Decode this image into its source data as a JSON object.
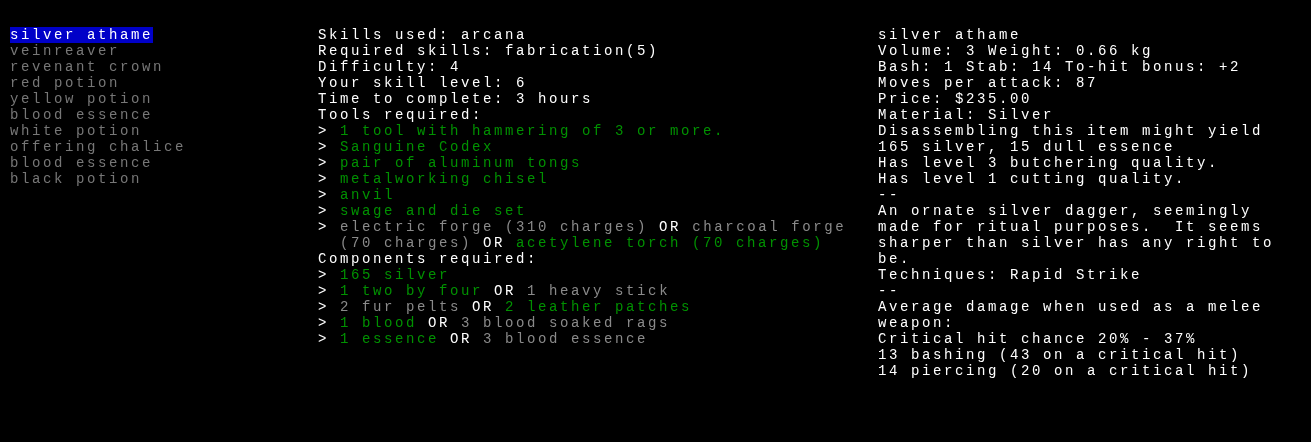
{
  "recipe_list": [
    {
      "label": "silver athame",
      "selected": true
    },
    {
      "label": "veinreaver",
      "selected": false
    },
    {
      "label": "revenant crown",
      "selected": false
    },
    {
      "label": "red potion",
      "selected": false
    },
    {
      "label": "yellow potion",
      "selected": false
    },
    {
      "label": "blood essence",
      "selected": false
    },
    {
      "label": "white potion",
      "selected": false
    },
    {
      "label": "offering chalice",
      "selected": false
    },
    {
      "label": "blood essence",
      "selected": false
    },
    {
      "label": "black potion",
      "selected": false
    }
  ],
  "recipe": {
    "info_lines": [
      "Skills used: arcana",
      "Required skills: fabrication(5)",
      "Difficulty: 4",
      "Your skill level: 6",
      "Time to complete: 3 hours"
    ],
    "tools_heading": "Tools required:",
    "tools": [
      {
        "marker": ">",
        "segments": [
          {
            "kind": "item",
            "text": "1 tool with hammering of 3 or more.",
            "available": true
          }
        ]
      },
      {
        "marker": ">",
        "segments": [
          {
            "kind": "item",
            "text": "Sanguine Codex",
            "available": true
          }
        ]
      },
      {
        "marker": ">",
        "segments": [
          {
            "kind": "item",
            "text": "pair of aluminum tongs",
            "available": true
          }
        ]
      },
      {
        "marker": ">",
        "segments": [
          {
            "kind": "item",
            "text": "metalworking chisel",
            "available": true
          }
        ]
      },
      {
        "marker": ">",
        "segments": [
          {
            "kind": "item",
            "text": "anvil",
            "available": true
          }
        ]
      },
      {
        "marker": ">",
        "segments": [
          {
            "kind": "item",
            "text": "swage and die set",
            "available": true
          }
        ]
      },
      {
        "marker": ">",
        "segments": [
          {
            "kind": "item",
            "text": "electric forge (310 charges)",
            "available": false
          },
          {
            "kind": "or",
            "text": "OR"
          },
          {
            "kind": "item",
            "text": "charcoal forge",
            "available": false
          },
          {
            "kind": "item",
            "text": "(70 charges)",
            "available": false
          },
          {
            "kind": "or",
            "text": "OR"
          },
          {
            "kind": "item",
            "text": "acetylene torch (70 charges)",
            "available": true
          }
        ]
      }
    ],
    "components_heading": "Components required:",
    "components": [
      {
        "marker": ">",
        "segments": [
          {
            "kind": "item",
            "text": "165 silver",
            "available": true
          }
        ]
      },
      {
        "marker": ">",
        "segments": [
          {
            "kind": "item",
            "text": "1 two by four",
            "available": true
          },
          {
            "kind": "or",
            "text": "OR"
          },
          {
            "kind": "item",
            "text": "1 heavy stick",
            "available": false
          }
        ]
      },
      {
        "marker": ">",
        "segments": [
          {
            "kind": "item",
            "text": "2 fur pelts",
            "available": false
          },
          {
            "kind": "or",
            "text": "OR"
          },
          {
            "kind": "item",
            "text": "2 leather patches",
            "available": true
          }
        ]
      },
      {
        "marker": ">",
        "segments": [
          {
            "kind": "item",
            "text": "1 blood",
            "available": true
          },
          {
            "kind": "or",
            "text": "OR"
          },
          {
            "kind": "item",
            "text": "3 blood soaked rags",
            "available": false
          }
        ]
      },
      {
        "marker": ">",
        "segments": [
          {
            "kind": "item",
            "text": "1 essence",
            "available": true
          },
          {
            "kind": "or",
            "text": "OR"
          },
          {
            "kind": "item",
            "text": "3 blood essence",
            "available": false
          }
        ]
      }
    ]
  },
  "item_info": {
    "lines": [
      "silver athame",
      "Volume: 3 Weight: 0.66 kg",
      "Bash: 1 Stab: 14 To-hit bonus: +2",
      "Moves per attack: 87",
      "Price: $235.00",
      "Material: Silver",
      "Disassembling this item might yield 165 silver, 15 dull essence",
      "Has level 3 butchering quality.",
      "Has level 1 cutting quality.",
      "--",
      "An ornate silver dagger, seemingly made for ritual purposes.  It seems sharper than silver has any right to be.",
      "Techniques: Rapid Strike",
      "--",
      "Average damage when used as a melee weapon:",
      "Critical hit chance 20% - 37%",
      "13 bashing (43 on a critical hit)",
      "14 piercing (20 on a critical hit)"
    ]
  }
}
